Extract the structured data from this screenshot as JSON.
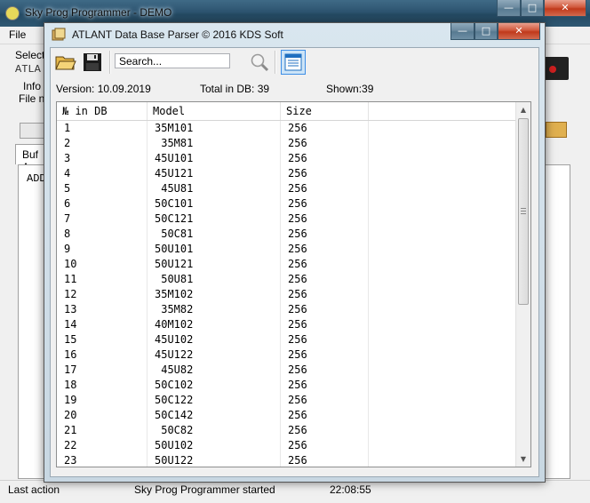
{
  "main_window": {
    "title": "Sky Prog Programmer - DEMO",
    "menu": [
      "File"
    ],
    "side_labels": [
      "Selecte",
      "ATLA",
      "Info I",
      "File no",
      "Buf A",
      "ADD"
    ],
    "status": {
      "left": "Last action",
      "middle": "Sky Prog Programmer started",
      "time": "22:08:55"
    },
    "caption_buttons": {
      "minimize": "—",
      "maximize": "□",
      "close": "✕"
    }
  },
  "dialog": {
    "title": "ATLANT Data Base Parser © 2016 KDS Soft",
    "caption_buttons": {
      "minimize": "—",
      "maximize": "□",
      "close": "✕"
    },
    "toolbar": {
      "open_icon": "open-folder-icon",
      "save_icon": "floppy-disk-icon",
      "search_placeholder": "Search...",
      "search_icon": "magnifier-icon",
      "view_icon": "list-view-icon"
    },
    "info": {
      "version": "Version: 10.09.2019",
      "total": "Total in DB: 39",
      "shown": "Shown:39"
    },
    "table": {
      "columns": [
        "№ in DB",
        "Model",
        "Size"
      ],
      "rows": [
        {
          "n": "1",
          "model": "35M101",
          "size": "256"
        },
        {
          "n": "2",
          "model": "35M81",
          "size": "256"
        },
        {
          "n": "3",
          "model": "45U101",
          "size": "256"
        },
        {
          "n": "4",
          "model": "45U121",
          "size": "256"
        },
        {
          "n": "5",
          "model": "45U81",
          "size": "256"
        },
        {
          "n": "6",
          "model": "50C101",
          "size": "256"
        },
        {
          "n": "7",
          "model": "50C121",
          "size": "256"
        },
        {
          "n": "8",
          "model": "50C81",
          "size": "256"
        },
        {
          "n": "9",
          "model": "50U101",
          "size": "256"
        },
        {
          "n": "10",
          "model": "50U121",
          "size": "256"
        },
        {
          "n": "11",
          "model": "50U81",
          "size": "256"
        },
        {
          "n": "12",
          "model": "35M102",
          "size": "256"
        },
        {
          "n": "13",
          "model": "35M82",
          "size": "256"
        },
        {
          "n": "14",
          "model": "40M102",
          "size": "256"
        },
        {
          "n": "15",
          "model": "45U102",
          "size": "256"
        },
        {
          "n": "16",
          "model": "45U122",
          "size": "256"
        },
        {
          "n": "17",
          "model": "45U82",
          "size": "256"
        },
        {
          "n": "18",
          "model": "50C102",
          "size": "256"
        },
        {
          "n": "19",
          "model": "50C122",
          "size": "256"
        },
        {
          "n": "20",
          "model": "50C142",
          "size": "256"
        },
        {
          "n": "21",
          "model": "50C82",
          "size": "256"
        },
        {
          "n": "22",
          "model": "50U102",
          "size": "256"
        },
        {
          "n": "23",
          "model": "50U122",
          "size": "256"
        }
      ]
    }
  },
  "colors": {
    "accent": "#3f6a86",
    "close": "#c0391b",
    "selection": "#3d8ee6"
  }
}
